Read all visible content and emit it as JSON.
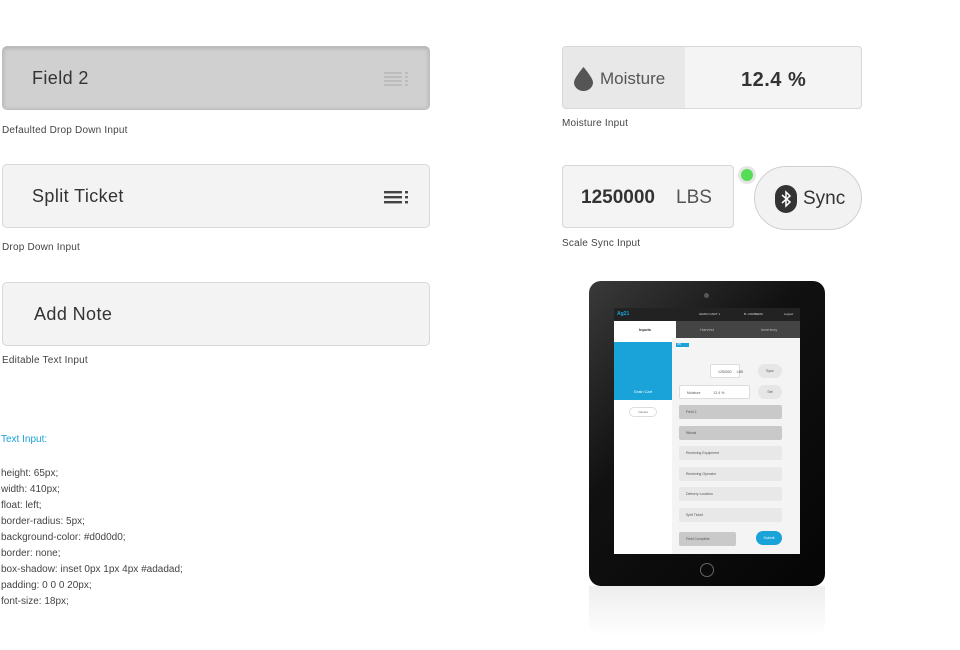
{
  "left": {
    "defaulted_input": {
      "value": "Field 2",
      "caption": "Defaulted Drop Down Input"
    },
    "dropdown_input": {
      "value": "Split Ticket",
      "caption": "Drop Down Input"
    },
    "editable_input": {
      "value": "Add Note",
      "caption": "Editable Text Input"
    },
    "spec": {
      "title": "Text Input:",
      "lines": [
        "height: 65px;",
        "width: 410px;",
        "float: left;",
        "border-radius: 5px;",
        "background-color: #d0d0d0;",
        "border: none;",
        "box-shadow: inset 0px 1px 4px #adadad;",
        "padding: 0 0 0 20px;",
        "font-size: 18px;"
      ]
    }
  },
  "moisture": {
    "label": "Moisture",
    "value": "12.4 %",
    "caption": "Moisture Input"
  },
  "scale": {
    "value": "1250000",
    "unit": "LBS",
    "sync_label": "Sync",
    "caption": "Scale Sync Input",
    "status_color": "#55dd55"
  },
  "tablet": {
    "logo": "Ag21",
    "top_left": "GRAIN CART 1",
    "top_user": "B. LINDBERG",
    "top_right": "Logout",
    "tabs": [
      "Inputs",
      "Harvest",
      "Inventory"
    ],
    "side_label": "Grain Cart",
    "cancel": "Cancel",
    "flag": "ON SCALE",
    "scale_value": "1250000",
    "scale_unit": "LBS",
    "sync": "Sync",
    "moisture_label": "Moisture",
    "moisture_value": "12.4 %",
    "set": "Set",
    "rows": [
      "Field 2",
      "Wheat",
      "Receiving Equipment",
      "Receiving Operator",
      "Delivery Location",
      "Split Ticket"
    ],
    "field_complete": "Field Complete",
    "submit": "Submit"
  },
  "colors": {
    "accent": "#1aa3d9",
    "defaulted_bg": "#d0d0d0",
    "input_bg": "#f3f3f3"
  }
}
